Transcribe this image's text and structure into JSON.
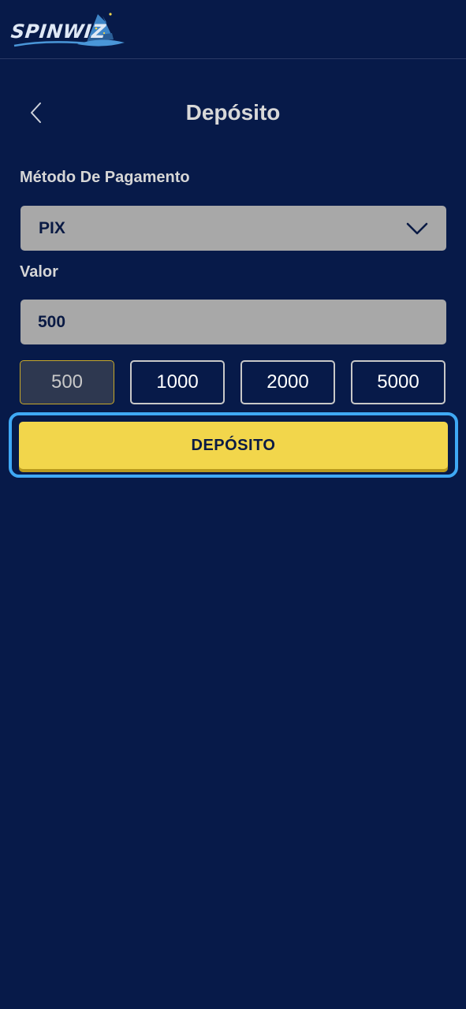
{
  "header": {
    "logo_text": "SPINWIZ"
  },
  "page": {
    "title": "Depósito"
  },
  "form": {
    "payment_method_label": "Método De Pagamento",
    "payment_method_value": "PIX",
    "amount_label": "Valor",
    "amount_value": "500",
    "quick_amounts": [
      "500",
      "1000",
      "2000",
      "5000"
    ],
    "selected_quick_amount": "500",
    "submit_label": "DEPÓSITO"
  },
  "colors": {
    "background": "#071a49",
    "field": "#a8a8a8",
    "accent_yellow": "#f2d64b",
    "focus_ring": "#3fa9f5"
  },
  "icons": {
    "back": "chevron-left-icon",
    "dropdown": "chevron-down-icon",
    "logo": "wizard-hat-icon"
  }
}
